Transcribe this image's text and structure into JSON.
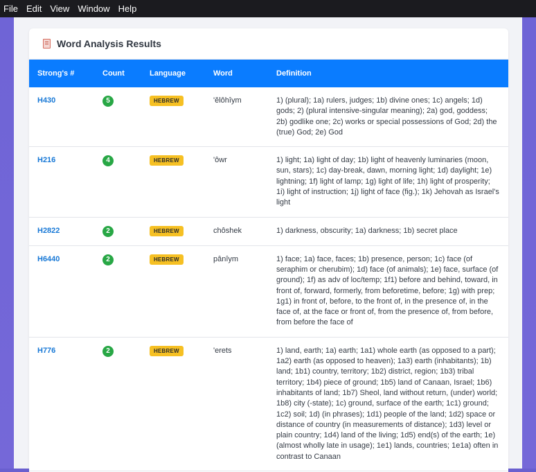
{
  "menubar": {
    "items": [
      "File",
      "Edit",
      "View",
      "Window",
      "Help"
    ]
  },
  "card": {
    "title": "Word Analysis Results",
    "icon": "document-icon"
  },
  "table": {
    "headers": [
      "Strong's #",
      "Count",
      "Language",
      "Word",
      "Definition"
    ],
    "rows": [
      {
        "strongs": "H430",
        "count": "5",
        "language": "HEBREW",
        "word": "'ĕlôhîym",
        "definition": "1) (plural); 1a) rulers, judges; 1b) divine ones; 1c) angels; 1d) gods; 2) (plural intensive-singular meaning); 2a) god, goddess; 2b) godlike one; 2c) works or special possessions of God; 2d) the (true) God; 2e) God"
      },
      {
        "strongs": "H216",
        "count": "4",
        "language": "HEBREW",
        "word": "'ôwr",
        "definition": "1) light; 1a) light of day; 1b) light of heavenly luminaries (moon, sun, stars); 1c) day-break, dawn, morning light; 1d) daylight; 1e) lightning; 1f) light of lamp; 1g) light of life; 1h) light of prosperity; 1i) light of instruction; 1j) light of face (fig.); 1k) Jehovah as Israel's light"
      },
      {
        "strongs": "H2822",
        "count": "2",
        "language": "HEBREW",
        "word": "chôshek",
        "definition": "1) darkness, obscurity; 1a) darkness; 1b) secret place"
      },
      {
        "strongs": "H6440",
        "count": "2",
        "language": "HEBREW",
        "word": "pânîym",
        "definition": "1) face; 1a) face, faces; 1b) presence, person; 1c) face (of seraphim or cherubim); 1d) face (of animals); 1e) face, surface (of ground); 1f) as adv of loc/temp; 1f1) before and behind, toward, in front of, forward, formerly, from beforetime, before; 1g) with prep; 1g1) in front of, before, to the front of, in the presence of, in the face of, at the face or front of, from the presence of, from before, from before the face of"
      },
      {
        "strongs": "H776",
        "count": "2",
        "language": "HEBREW",
        "word": "'erets",
        "definition": "1) land, earth; 1a) earth; 1a1) whole earth (as opposed to a part); 1a2) earth (as opposed to heaven); 1a3) earth (inhabitants); 1b) land; 1b1) country, territory; 1b2) district, region; 1b3) tribal territory; 1b4) piece of ground; 1b5) land of Canaan, Israel; 1b6) inhabitants of land; 1b7) Sheol, land without return, (under) world; 1b8) city (-state); 1c) ground, surface of the earth; 1c1) ground; 1c2) soil; 1d) (in phrases); 1d1) people of the land; 1d2) space or distance of country (in measurements of distance); 1d3) level or plain country; 1d4) land of the living; 1d5) end(s) of the earth; 1e) (almost wholly late in usage); 1e1) lands, countries; 1e1a) often in contrast to Canaan"
      }
    ]
  },
  "colors": {
    "header_bg": "#0a7cff",
    "link": "#1778d6",
    "count_badge": "#28a745",
    "language_badge": "#f6c023",
    "background": "#6f64d6"
  }
}
